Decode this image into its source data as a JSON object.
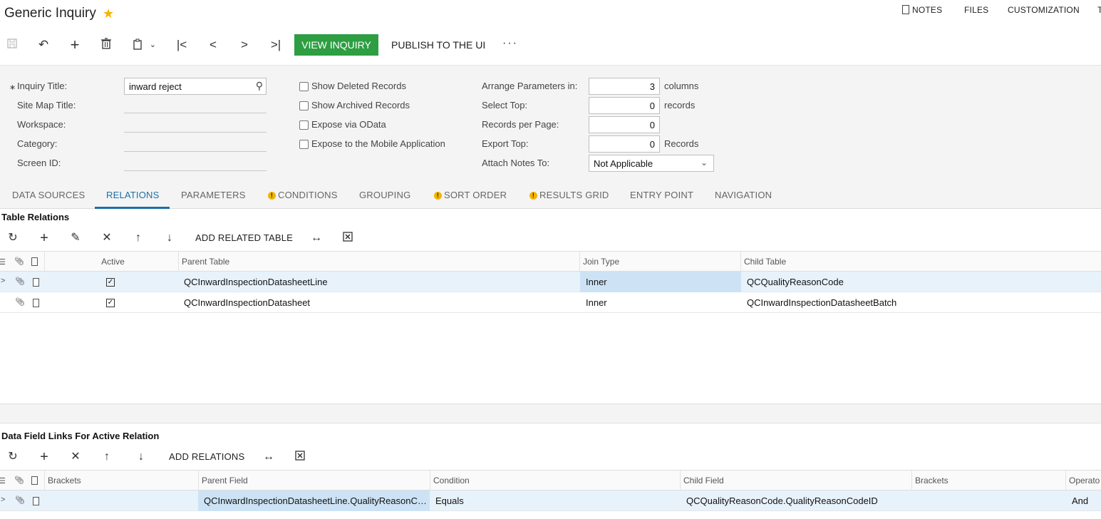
{
  "window": {
    "title": "Generic Inquiry"
  },
  "top_links": {
    "notes": "NOTES",
    "files": "FILES",
    "customization": "CUSTOMIZATION",
    "truncated": "T"
  },
  "toolbar": {
    "icons": [
      "save-icon",
      "undo-icon",
      "add-icon",
      "delete-icon",
      "copy-paste-icon",
      "first-icon",
      "prev-icon",
      "next-icon",
      "last-icon"
    ],
    "view_inquiry": "VIEW INQUIRY",
    "publish": "PUBLISH TO THE UI",
    "more": "···"
  },
  "form": {
    "inquiry_title_label": "Inquiry Title:",
    "inquiry_title_value": "inward reject",
    "site_map_title_label": "Site Map Title:",
    "workspace_label": "Workspace:",
    "category_label": "Category:",
    "screen_id_label": "Screen ID:",
    "show_deleted": "Show Deleted Records",
    "show_archived": "Show Archived Records",
    "expose_odata": "Expose via OData",
    "expose_mobile": "Expose to the Mobile Application",
    "arrange_label": "Arrange Parameters in:",
    "arrange_value": "3",
    "arrange_unit": "columns",
    "select_top_label": "Select Top:",
    "select_top_value": "0",
    "select_top_unit": "records",
    "records_per_page_label": "Records per Page:",
    "records_per_page_value": "0",
    "export_top_label": "Export Top:",
    "export_top_value": "0",
    "export_top_unit": "Records",
    "attach_notes_label": "Attach Notes To:",
    "attach_notes_value": "Not Applicable"
  },
  "tabs": [
    {
      "label": "DATA SOURCES",
      "warn": false
    },
    {
      "label": "RELATIONS",
      "warn": false,
      "active": true
    },
    {
      "label": "PARAMETERS",
      "warn": false
    },
    {
      "label": "CONDITIONS",
      "warn": true
    },
    {
      "label": "GROUPING",
      "warn": false
    },
    {
      "label": "SORT ORDER",
      "warn": true
    },
    {
      "label": "RESULTS GRID",
      "warn": true
    },
    {
      "label": "ENTRY POINT",
      "warn": false
    },
    {
      "label": "NAVIGATION",
      "warn": false
    }
  ],
  "relations": {
    "title": "Table Relations",
    "add_related": "ADD RELATED TABLE",
    "columns": {
      "active": "Active",
      "parent": "Parent Table",
      "join": "Join Type",
      "child": "Child Table"
    },
    "rows": [
      {
        "active": "✓",
        "parent": "QCInwardInspectionDatasheetLine",
        "join": "Inner",
        "child": "QCQualityReasonCode"
      },
      {
        "active": "✓",
        "parent": "QCInwardInspectionDatasheet",
        "join": "Inner",
        "child": "QCInwardInspectionDatasheetBatch"
      }
    ]
  },
  "links": {
    "title": "Data Field Links For Active Relation",
    "add_relations": "ADD RELATIONS",
    "columns": {
      "brackets1": "Brackets",
      "parent": "Parent Field",
      "condition": "Condition",
      "child": "Child Field",
      "brackets2": "Brackets",
      "operator": "Operato"
    },
    "rows": [
      {
        "brackets1": "",
        "parent": "QCInwardInspectionDatasheetLine.QualityReasonCodeID",
        "condition": "Equals",
        "child": "QCQualityReasonCode.QualityReasonCodeID",
        "brackets2": "",
        "operator": "And"
      }
    ]
  },
  "colors": {
    "accent": "#1d6fa5",
    "primary_button": "#2e9e43",
    "star": "#f5b400",
    "warning": "#f2b300"
  }
}
